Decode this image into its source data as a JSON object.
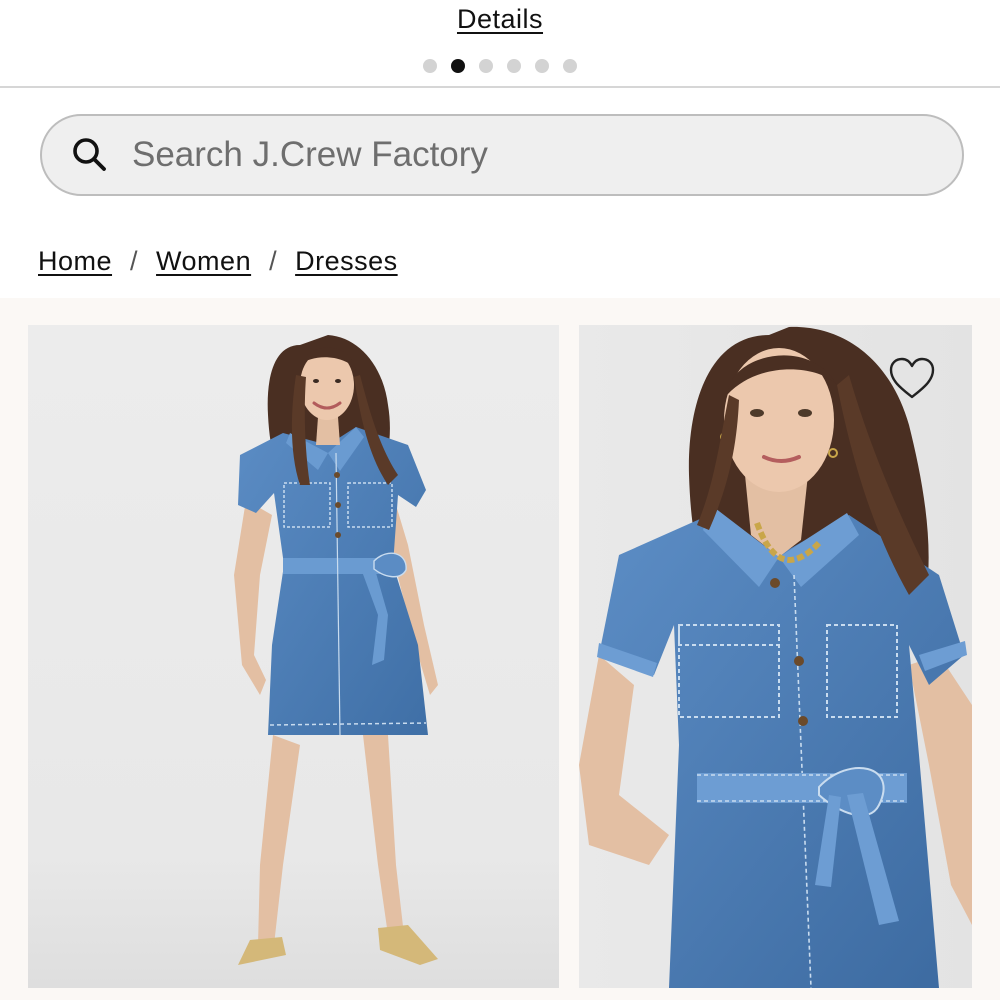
{
  "header": {
    "details_label": "Details",
    "carousel": {
      "total": 6,
      "active_index": 1
    }
  },
  "search": {
    "placeholder": "Search J.Crew Factory",
    "value": ""
  },
  "breadcrumb": {
    "items": [
      "Home",
      "Women",
      "Dresses"
    ],
    "separator": "/"
  },
  "products": [
    {
      "image": "model-full-length-denim-shirt-dress",
      "wishlist_icon": "heart-outline-icon"
    },
    {
      "image": "model-closeup-denim-shirt-dress",
      "wishlist_icon": "heart-outline-icon"
    }
  ],
  "colors": {
    "denim": "#4d7fb8",
    "gallery_bg": "#fbf8f5"
  }
}
